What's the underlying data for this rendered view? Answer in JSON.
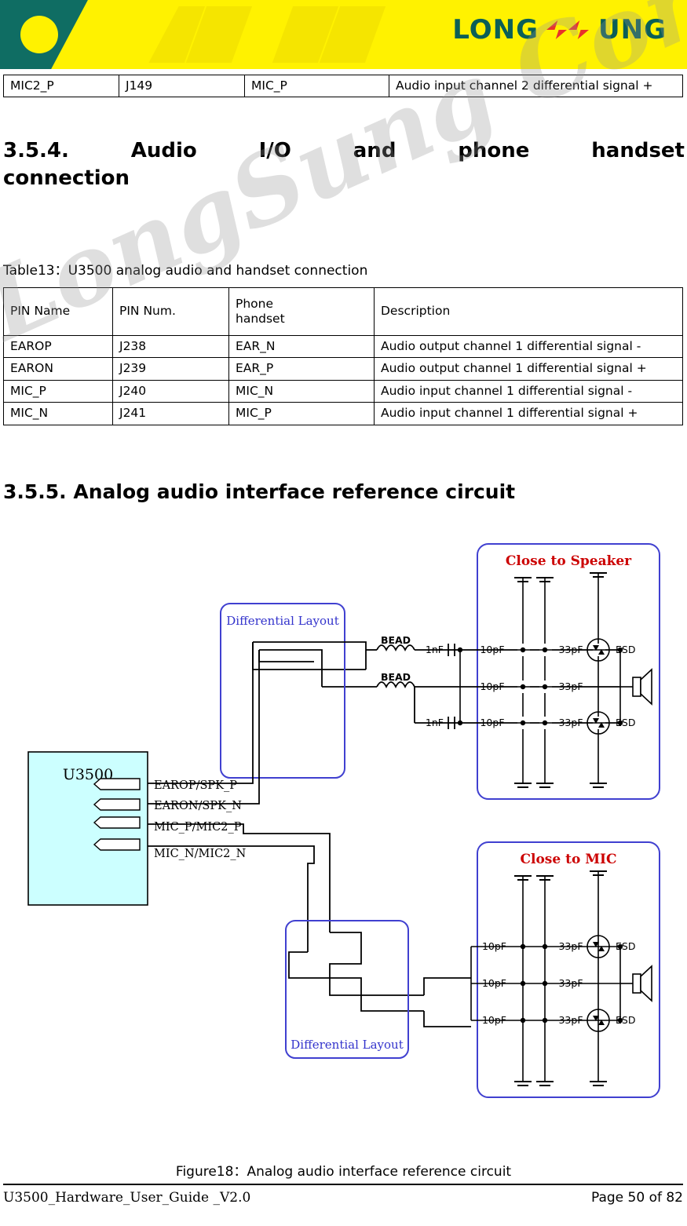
{
  "banner": {
    "brand": "LONG UNG",
    "logo_icon": "chevron-arrows-logo-icon"
  },
  "top_table": {
    "rows": [
      [
        "MIC2_P",
        "J149",
        "MIC_P",
        "Audio input channel 2 differential signal +"
      ]
    ]
  },
  "sections": {
    "s354": "3.5.4. Audio I/O and phone handset connection",
    "s354_line1": "3.5.4.   Audio   I/O   and   phone   handset",
    "s354_line2": "connection",
    "s355": "3.5.5. Analog audio interface reference circuit"
  },
  "table_caption": "Table13：U3500 analog audio and handset connection",
  "mid_table": {
    "headers": [
      "PIN Name",
      "PIN Num.",
      "Phone handset",
      "Description"
    ],
    "header_col3_line1": "Phone",
    "header_col3_line2": "handset",
    "rows": [
      [
        "EAROP",
        "J238",
        "EAR_N",
        "Audio output channel 1 differential signal -"
      ],
      [
        "EARON",
        "J239",
        "EAR_P",
        "Audio output channel 1 differential signal +"
      ],
      [
        "MIC_P",
        "J240",
        "MIC_N",
        "Audio input channel 1 differential signal -"
      ],
      [
        "MIC_N",
        "J241",
        "MIC_P",
        "Audio input channel 1 differential signal +"
      ]
    ]
  },
  "figure": {
    "caption": "Figure18：Analog audio interface reference circuit",
    "chip_label": "U3500",
    "pins": [
      "EAROP/SPK_P",
      "EARON/SPK_N",
      "MIC_P/MIC2_P",
      "MIC_N/MIC2_N"
    ],
    "diff_layout_top": "Differential Layout",
    "diff_layout_bottom": "Differential Layout",
    "speaker_box_title": "Close to Speaker",
    "mic_box_title": "Close to MIC",
    "bead_labels": [
      "BEAD",
      "BEAD"
    ],
    "speaker_caps": {
      "series_left": [
        "1nF",
        "1nF"
      ],
      "rows": [
        {
          "c1": "10pF",
          "c2": "33pF",
          "esd": "ESD"
        },
        {
          "c1": "10pF",
          "c2": "33pF",
          "esd": ""
        },
        {
          "c1": "10pF",
          "c2": "33pF",
          "esd": "ESD"
        }
      ]
    },
    "mic_caps": {
      "rows": [
        {
          "c1": "10pF",
          "c2": "33pF",
          "esd": "ESD"
        },
        {
          "c1": "10pF",
          "c2": "33pF",
          "esd": ""
        },
        {
          "c1": "10pF",
          "c2": "33pF",
          "esd": "ESD"
        }
      ]
    },
    "colors": {
      "chip_fill": "#ccffff",
      "box_border": "#4040d0",
      "title_text": "#cc0000",
      "label_text": "#3333cc"
    }
  },
  "watermark": "LongSung Confidential",
  "footer": {
    "left": "U3500_Hardware_User_Guide _V2.0",
    "right": "Page 50 of 82",
    "left_prefix": "U3500",
    "left_rest": "_Hardware_User_Guide _V2.0"
  }
}
